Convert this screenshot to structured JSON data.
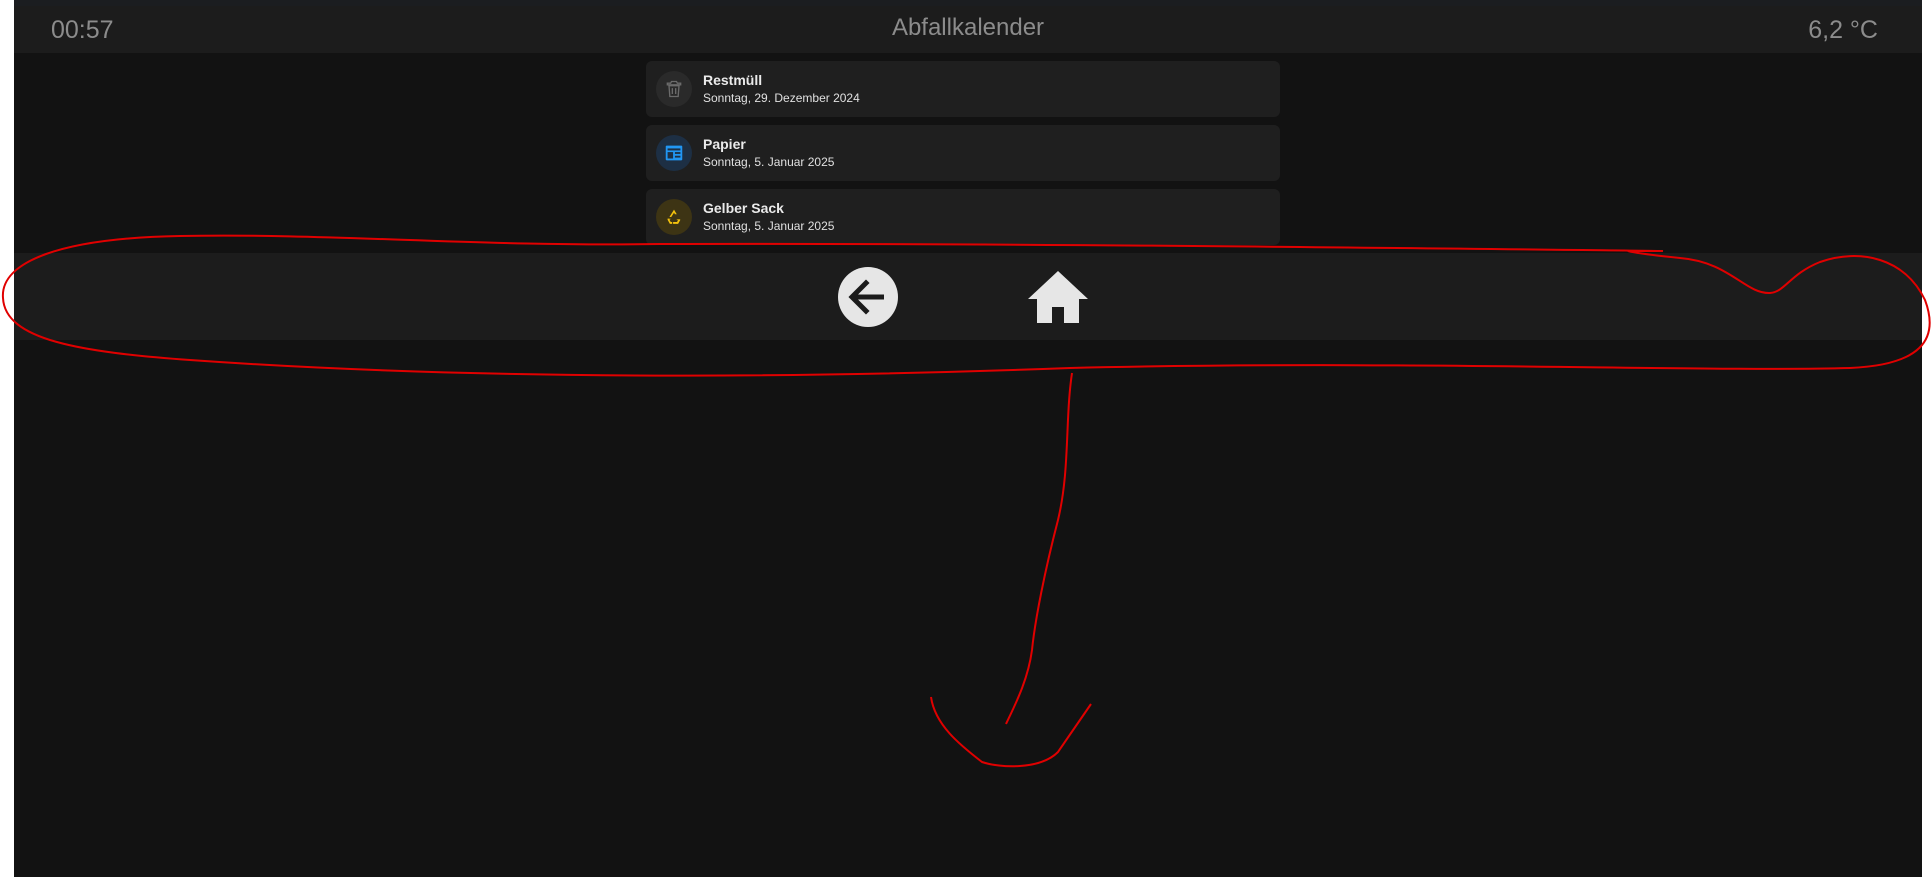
{
  "header": {
    "time": "00:57",
    "title": "Abfallkalender",
    "temperature": "6,2 °C"
  },
  "items": [
    {
      "name": "Restmüll",
      "date": "Sonntag, 29. Dezember 2024",
      "icon": "trash-can-icon",
      "color": "#6b6b6b"
    },
    {
      "name": "Papier",
      "date": "Sonntag, 5. Januar 2025",
      "icon": "newspaper-icon",
      "color": "#2196f3"
    },
    {
      "name": "Gelber Sack",
      "date": "Sonntag, 5. Januar 2025",
      "icon": "recycle-icon",
      "color": "#f4c20d"
    }
  ],
  "nav": {
    "back_icon": "arrow-left-circle-icon",
    "home_icon": "home-icon"
  },
  "colors": {
    "background": "#121212",
    "panel": "#1c1c1c",
    "annotation": "#e00000"
  }
}
